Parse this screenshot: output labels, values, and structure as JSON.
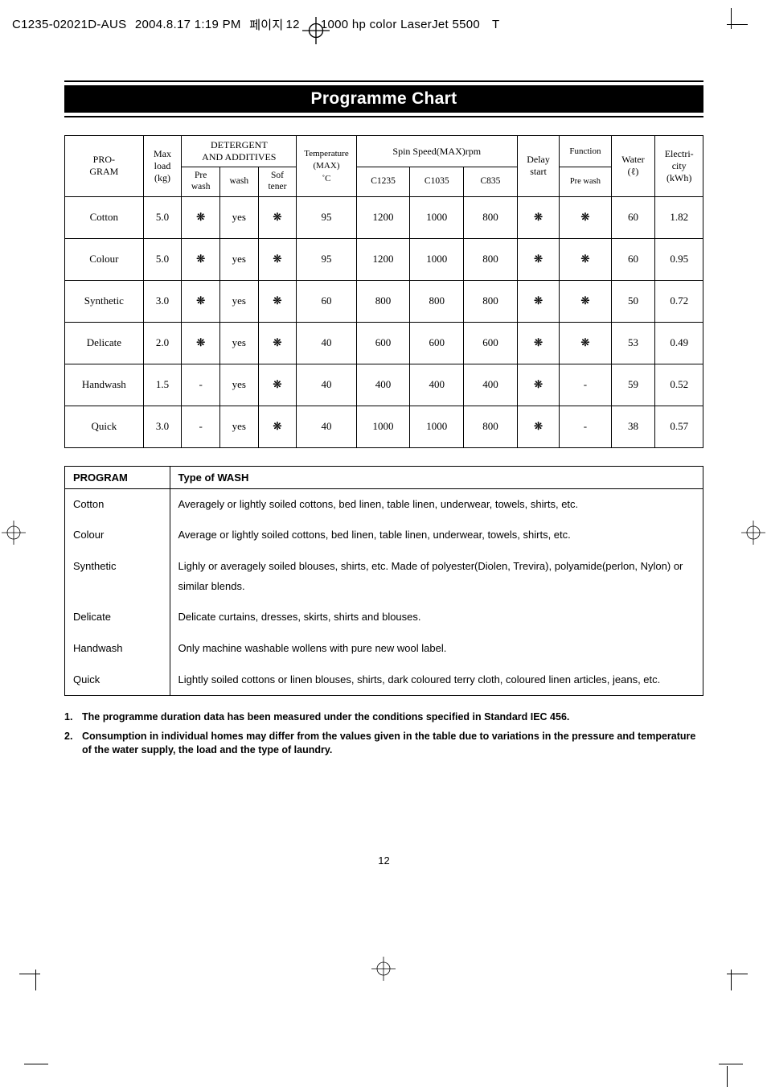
{
  "print_header": {
    "filename": "C1235-02021D-AUS",
    "datetime": "2004.8.17 1:19 PM",
    "page_word_prefix": "페이지",
    "page_num": "12",
    "printer": "1000 hp color LaserJet 5500",
    "suffix": "T"
  },
  "title": "Programme Chart",
  "headers": {
    "program": "PRO-\nGRAM",
    "maxload": "Max\nload\n(kg)",
    "detergent_group": "DETERGENT\nAND ADDITIVES",
    "prewash": "Pre\nwash",
    "wash": "wash",
    "softener": "Sof\ntener",
    "temperature": "Temperature\n(MAX)\n˚C",
    "spin_group": "Spin Speed(MAX)rpm",
    "spin_c1235": "C1235",
    "spin_c1035": "C1035",
    "spin_c835": "C835",
    "delay": "Delay\nstart",
    "function_group": "Function",
    "function_prewash": "Pre wash",
    "water": "Water\n(ℓ)",
    "electricity": "Electri-\ncity\n(kWh)"
  },
  "rows": [
    {
      "program": "Cotton",
      "max": "5.0",
      "pre": "❊",
      "wash": "yes",
      "sof": "❊",
      "temp": "95",
      "s1": "1200",
      "s2": "1000",
      "s3": "800",
      "delay": "❊",
      "func": "❊",
      "water": "60",
      "elec": "1.82"
    },
    {
      "program": "Colour",
      "max": "5.0",
      "pre": "❊",
      "wash": "yes",
      "sof": "❊",
      "temp": "95",
      "s1": "1200",
      "s2": "1000",
      "s3": "800",
      "delay": "❊",
      "func": "❊",
      "water": "60",
      "elec": "0.95"
    },
    {
      "program": "Synthetic",
      "max": "3.0",
      "pre": "❊",
      "wash": "yes",
      "sof": "❊",
      "temp": "60",
      "s1": "800",
      "s2": "800",
      "s3": "800",
      "delay": "❊",
      "func": "❊",
      "water": "50",
      "elec": "0.72"
    },
    {
      "program": "Delicate",
      "max": "2.0",
      "pre": "❊",
      "wash": "yes",
      "sof": "❊",
      "temp": "40",
      "s1": "600",
      "s2": "600",
      "s3": "600",
      "delay": "❊",
      "func": "❊",
      "water": "53",
      "elec": "0.49"
    },
    {
      "program": "Handwash",
      "max": "1.5",
      "pre": "-",
      "wash": "yes",
      "sof": "❊",
      "temp": "40",
      "s1": "400",
      "s2": "400",
      "s3": "400",
      "delay": "❊",
      "func": "-",
      "water": "59",
      "elec": "0.52"
    },
    {
      "program": "Quick",
      "max": "3.0",
      "pre": "-",
      "wash": "yes",
      "sof": "❊",
      "temp": "40",
      "s1": "1000",
      "s2": "1000",
      "s3": "800",
      "delay": "❊",
      "func": "-",
      "water": "38",
      "elec": "0.57"
    }
  ],
  "wash_headers": {
    "program": "PROGRAM",
    "type": "Type of WASH"
  },
  "wash_rows": [
    {
      "program": "Cotton",
      "text": "Averagely or lightly soiled cottons, bed linen, table linen, underwear, towels, shirts, etc."
    },
    {
      "program": "Colour",
      "text": "Average or lightly soiled cottons, bed linen, table linen, underwear, towels, shirts, etc."
    },
    {
      "program": "Synthetic",
      "text": "Lighly or averagely soiled blouses, shirts, etc. Made of polyester(Diolen, Trevira), polyamide(perlon, Nylon) or similar blends."
    },
    {
      "program": "Delicate",
      "text": "Delicate curtains, dresses, skirts, shirts and blouses."
    },
    {
      "program": "Handwash",
      "text": "Only machine washable wollens with pure new wool label."
    },
    {
      "program": "Quick",
      "text": "Lightly soiled cottons or linen blouses, shirts, dark coloured terry cloth, coloured linen articles, jeans, etc."
    }
  ],
  "notes": [
    "The programme duration data has been measured under the conditions specified in Standard IEC 456.",
    "Consumption in individual homes may differ from the values given in the table due to variations in the pressure and temperature of the water supply, the load and the type of laundry."
  ],
  "page_number": "12",
  "chart_data": {
    "type": "table",
    "title": "Programme Chart",
    "columns": [
      "PROGRAM",
      "Max load (kg)",
      "Pre wash",
      "wash",
      "Softener",
      "Temperature (MAX) ˚C",
      "Spin C1235",
      "Spin C1035",
      "Spin C835",
      "Delay start",
      "Function Pre wash",
      "Water (ℓ)",
      "Electricity (kWh)"
    ],
    "rows": [
      [
        "Cotton",
        5.0,
        "❊",
        "yes",
        "❊",
        95,
        1200,
        1000,
        800,
        "❊",
        "❊",
        60,
        1.82
      ],
      [
        "Colour",
        5.0,
        "❊",
        "yes",
        "❊",
        95,
        1200,
        1000,
        800,
        "❊",
        "❊",
        60,
        0.95
      ],
      [
        "Synthetic",
        3.0,
        "❊",
        "yes",
        "❊",
        60,
        800,
        800,
        800,
        "❊",
        "❊",
        50,
        0.72
      ],
      [
        "Delicate",
        2.0,
        "❊",
        "yes",
        "❊",
        40,
        600,
        600,
        600,
        "❊",
        "❊",
        53,
        0.49
      ],
      [
        "Handwash",
        1.5,
        "-",
        "yes",
        "❊",
        40,
        400,
        400,
        400,
        "❊",
        "-",
        59,
        0.52
      ],
      [
        "Quick",
        3.0,
        "-",
        "yes",
        "❊",
        40,
        1000,
        1000,
        800,
        "❊",
        "-",
        38,
        0.57
      ]
    ]
  }
}
